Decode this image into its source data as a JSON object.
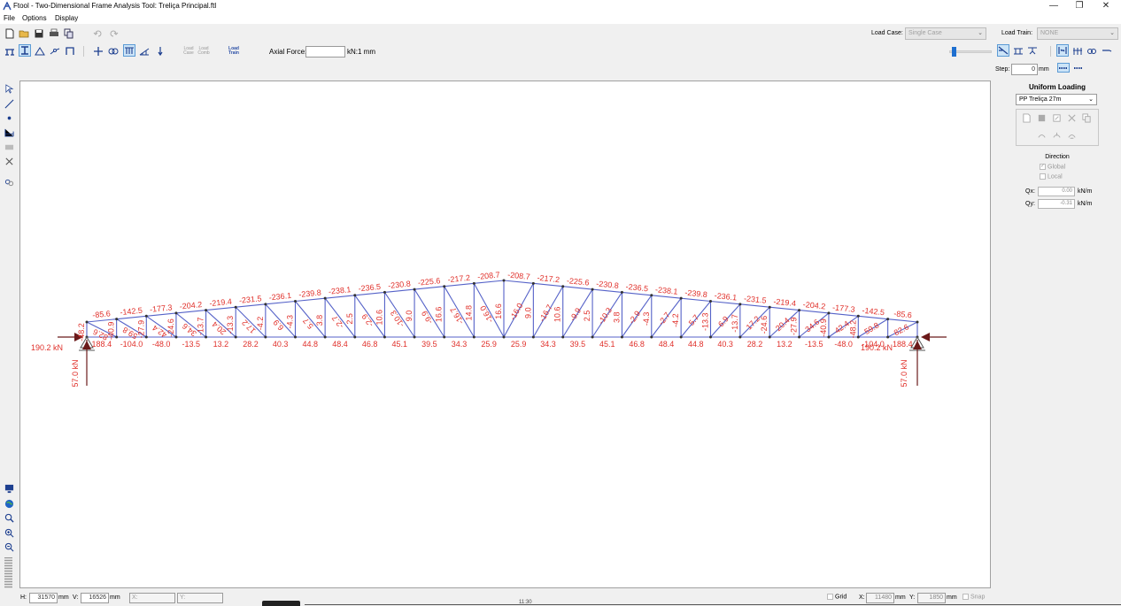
{
  "window": {
    "title": "Ftool - Two-Dimensional Frame Analysis Tool: Treliça Principal.ftl",
    "minimize": "—",
    "restore": "❐",
    "close": "✕"
  },
  "menu": [
    "File",
    "Options",
    "Display"
  ],
  "toolbar": {
    "load_case_label": "Load Case:",
    "load_case_value": "Single Case",
    "load_train_label": "Load Train:",
    "load_train_value": "NONE",
    "small_labels": [
      "Load\nCase",
      "Load\nComb",
      "Load\nTrain"
    ],
    "axial_force_label": "Axial Force:",
    "axial_force_value": "",
    "axial_force_unit": "kN:1 mm",
    "step_label": "Step:",
    "step_value": "0",
    "step_unit": "mm"
  },
  "panel": {
    "title": "Uniform Loading",
    "loading_selected": "PP Treliça 27m",
    "direction_label": "Direction",
    "global_label": "Global",
    "global_checked": true,
    "local_label": "Local",
    "local_checked": false,
    "qx_label": "Qx:",
    "qx_value": "0.00",
    "qx_unit": "kN/m",
    "qy_label": "Qy:",
    "qy_value": "-0.31",
    "qy_unit": "kN/m"
  },
  "status": {
    "h_label": "H:",
    "h_value": "31570",
    "h_unit": "mm",
    "v_label": "V:",
    "v_value": "16526",
    "v_unit": "mm",
    "x_label": "X:",
    "y_label": "Y:",
    "grid_label": "Grid",
    "grid_checked": false,
    "cx_label": "X:",
    "cx_value": "11480",
    "cx_unit": "mm",
    "cy_label": "Y:",
    "cy_value": "1850",
    "cy_unit": "mm",
    "snap_label": "Snap",
    "video_time": "11:30"
  },
  "diagram": {
    "reactions": {
      "left_horizontal": "190.2 kN",
      "left_vertical": "57.0 kN",
      "right_horizontal": "190.2 kN",
      "right_vertical": "57.0 kN"
    },
    "top_chord_left": [
      "-85.6",
      "-142.5",
      "-177.3",
      "-204.2",
      "-219.4",
      "-231.5",
      "-236.1",
      "-239.8",
      "-238.1",
      "-236.5",
      "-230.8",
      "-225.6",
      "-217.2",
      "-208.7"
    ],
    "top_chord_right": [
      "-208.7",
      "-217.2",
      "-225.6",
      "-230.8",
      "-236.5",
      "-238.1",
      "-239.8",
      "-236.1",
      "-231.5",
      "-219.4",
      "-204.2",
      "-177.3",
      "-142.5",
      "-85.6"
    ],
    "bottom_chord_left": [
      "188.4",
      "-104.0",
      "-48.0",
      "-13.5",
      "13.2",
      "28.2",
      "40.3",
      "44.8",
      "48.4",
      "46.8",
      "45.1",
      "39.5",
      "34.3",
      "25.9"
    ],
    "bottom_chord_right": [
      "25.9",
      "34.3",
      "39.5",
      "45.1",
      "46.8",
      "48.4",
      "44.8",
      "40.3",
      "28.2",
      "13.2",
      "-13.5",
      "-48.0",
      "-104.0",
      "188.4"
    ],
    "verticals_left": [
      "-48.2",
      "-40.9",
      "-27.9",
      "-24.6",
      "-13.7",
      "-13.3",
      "-4.2",
      "-4.3",
      "3.8",
      "2.5",
      "10.6",
      "9.0",
      "16.6",
      "14.8"
    ],
    "verticals_right": [
      "14.8",
      "16.6",
      "9.0",
      "10.6",
      "2.5",
      "3.8",
      "-4.3",
      "-4.2",
      "-13.3",
      "-13.7",
      "-24.6",
      "-27.9",
      "-40.9",
      "-48.2"
    ],
    "diagonals_left": [
      "82.6",
      "59.8",
      "42.4",
      "34.6",
      "20.4",
      "17.2",
      "6.9",
      "5.7",
      "-2.7",
      "-2.9",
      "-10.3",
      "-9.9",
      "-16.7",
      "-16.0"
    ],
    "diagonals_right": [
      "-16.0",
      "-16.7",
      "-9.9",
      "-10.3",
      "-2.9",
      "-2.7",
      "5.7",
      "6.9",
      "17.2",
      "20.4",
      "34.6",
      "42.4",
      "59.8",
      "82.6"
    ]
  }
}
